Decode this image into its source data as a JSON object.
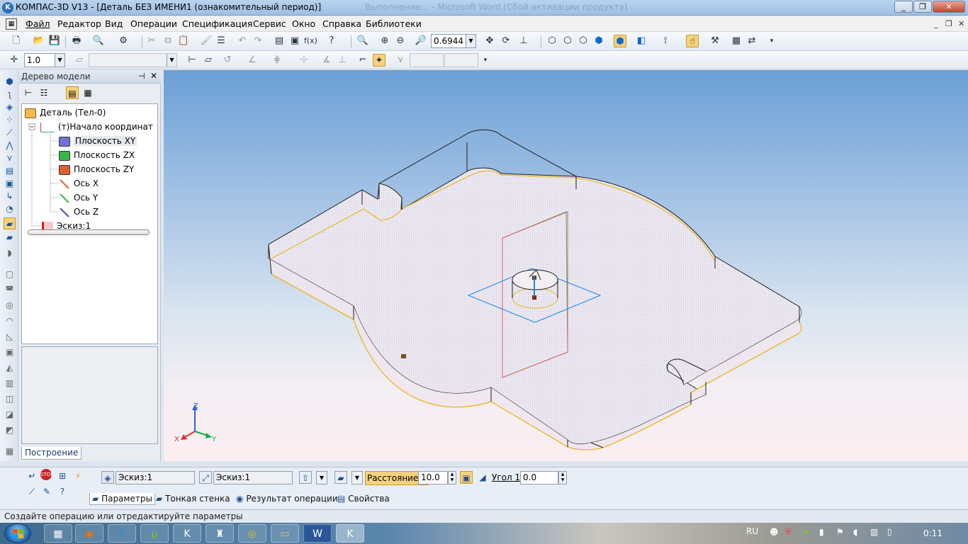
{
  "window": {
    "app_title": "КОМПАС-3D V13",
    "doc_title": " - [Деталь БЕЗ ИМЕНИ1 (ознакомительный период)]",
    "ghost_title": "Выполнение... - Microsoft Word (Сбой активации продукта)",
    "minimize_glyph": "_",
    "maximize_glyph": "❐",
    "close_glyph": "✕"
  },
  "menu": {
    "items": [
      "Файл",
      "Редактор",
      "Вид",
      "Операции",
      "Спецификация",
      "Сервис",
      "Окно",
      "Справка",
      "Библиотеки"
    ],
    "mdi_min": "_",
    "mdi_restore": "❐",
    "mdi_close": "✕"
  },
  "toolbar1": {
    "zoom_value": "0.6944"
  },
  "toolbar2": {
    "step_value": "1.0"
  },
  "tree": {
    "title": "Дерево модели",
    "pin": "⊣",
    "close": "✕",
    "nodes": [
      {
        "label": "Деталь (Тел-0)"
      },
      {
        "label": "(т)Начало координат"
      },
      {
        "label": "Плоскость XY"
      },
      {
        "label": "Плоскость ZX"
      },
      {
        "label": "Плоскость ZY"
      },
      {
        "label": "Ось X"
      },
      {
        "label": "Ось Y"
      },
      {
        "label": "Ось Z"
      },
      {
        "label": "Эскиз:1"
      }
    ],
    "tab_label": "Построение"
  },
  "viewport": {
    "axis_x": "X",
    "axis_y": "Y",
    "axis_z": "Z"
  },
  "props": {
    "sketch1": "Эскиз:1",
    "sketch2": "Эскиз:1",
    "distance_label_main": "Расстояние ",
    "distance_label_idx": "1",
    "distance_value": "10.0",
    "angle_label": "Угол 1",
    "angle_value": "0.0",
    "tabs": [
      "Параметры",
      "Тонкая стенка",
      "Результат операции",
      "Свойства"
    ]
  },
  "status": {
    "text": "Создайте операцию или отредактируйте параметры"
  },
  "taskbar": {
    "lang": "RU",
    "clock": "0:11"
  },
  "colors": {
    "accent": "#f6d27a",
    "axis_x": "#e0302a",
    "axis_y": "#1aa84a",
    "axis_z": "#2a67d6",
    "plane_xy": "#7070d8",
    "plane_zx": "#38b84a",
    "plane_zy": "#e06030"
  }
}
